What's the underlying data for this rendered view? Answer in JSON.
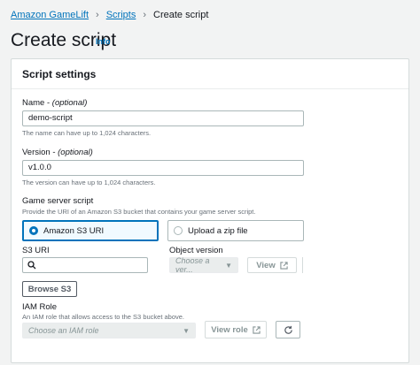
{
  "breadcrumb": {
    "root": "Amazon GameLift",
    "parent": "Scripts",
    "current": "Create script"
  },
  "page": {
    "title": "Create script",
    "info": "Info"
  },
  "panel": {
    "title": "Script settings",
    "name": {
      "label": "Name - ",
      "optional": "(optional)",
      "value": "demo-script",
      "description": "The name can have up to 1,024 characters."
    },
    "version": {
      "label": "Version - ",
      "optional": "(optional)",
      "value": "v1.0.0",
      "description": "The version can have up to 1,024 characters."
    },
    "server_script": {
      "label": "Game server script",
      "description": "Provide the URI of an Amazon S3 bucket that contains your game server script.",
      "option_s3": "Amazon S3 URI",
      "option_zip": "Upload a zip file"
    },
    "s3_uri": {
      "label": "S3 URI",
      "value": "",
      "browse": "Browse S3"
    },
    "object_version": {
      "label": "Object version",
      "placeholder": "Choose a ver...",
      "view": "View"
    },
    "iam_role": {
      "label": "IAM Role",
      "description": "An IAM role that allows access to the S3 bucket above.",
      "placeholder": "Choose an IAM role",
      "view_role": "View role"
    }
  },
  "colors": {
    "link": "#0073bb",
    "selected_border": "#0073bb",
    "disabled_bg": "#eaeded"
  }
}
